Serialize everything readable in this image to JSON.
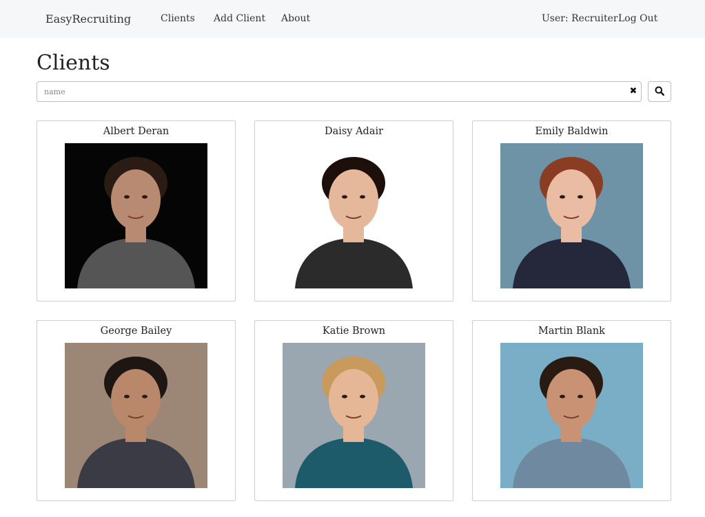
{
  "navbar": {
    "brand": "EasyRecruiting",
    "links": [
      "Clients",
      "Add Client",
      "About"
    ],
    "user": "User: Recruiter",
    "logout": "Log Out"
  },
  "page": {
    "title": "Clients"
  },
  "search": {
    "value": "",
    "placeholder": "name",
    "clear_icon": "close-icon",
    "search_icon": "search-icon"
  },
  "clients": [
    {
      "name": "Albert Deran",
      "bg": "#050505",
      "skin": "#b98a72",
      "hair": "#2a1c14",
      "shirt": "#555555"
    },
    {
      "name": "Daisy Adair",
      "bg": "#ffffff",
      "skin": "#e5b89c",
      "hair": "#1d0f0a",
      "shirt": "#2b2b2b"
    },
    {
      "name": "Emily Baldwin",
      "bg": "#6e93a6",
      "skin": "#e9bca3",
      "hair": "#8a3d22",
      "shirt": "#25283a"
    },
    {
      "name": "George Bailey",
      "bg": "#9c8676",
      "skin": "#b9876a",
      "hair": "#1e1612",
      "shirt": "#3b3b45"
    },
    {
      "name": "Katie Brown",
      "bg": "#9aa7b0",
      "skin": "#e6b797",
      "hair": "#c89a5b",
      "shirt": "#1d5a6a"
    },
    {
      "name": "Martin Blank",
      "bg": "#7aaec6",
      "skin": "#c99274",
      "hair": "#2a1b12",
      "shirt": "#6f8aa0"
    }
  ]
}
